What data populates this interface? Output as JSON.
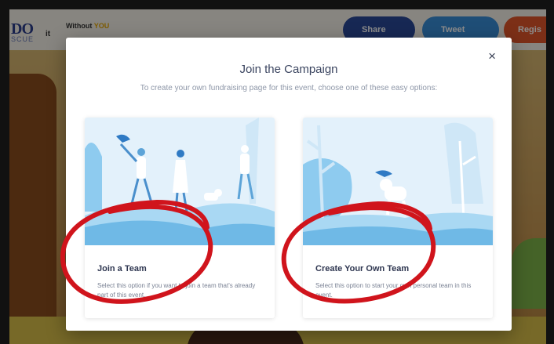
{
  "background_page": {
    "logo_text": "DO",
    "logo_sub": "SCUE",
    "logo_fragment": "it",
    "tagline_prefix": "Without",
    "tagline_highlight": "YOU",
    "share_label": "Share",
    "tweet_label": "Tweet",
    "register_label": "Regis"
  },
  "modal": {
    "close_label": "×",
    "title": "Join the Campaign",
    "subtitle": "To create your own fundraising page for this event, choose one of these easy options:",
    "options": [
      {
        "title": "Join a Team",
        "description": "Select this option if you want to join a team that's already part of this event.",
        "illustration": "people-walking-dog-illustration"
      },
      {
        "title": "Create Your Own Team",
        "description": "Select this option to start your own personal team in this event.",
        "illustration": "dog-with-frisbee-illustration"
      }
    ]
  },
  "colors": {
    "annotation_red": "#d0141c",
    "illustration_sky": "#e3f1fb",
    "illustration_blue": "#8ecbef",
    "share_blue": "#2a4a9a",
    "tweet_blue": "#3a8fd9",
    "register_orange": "#e2572b"
  }
}
